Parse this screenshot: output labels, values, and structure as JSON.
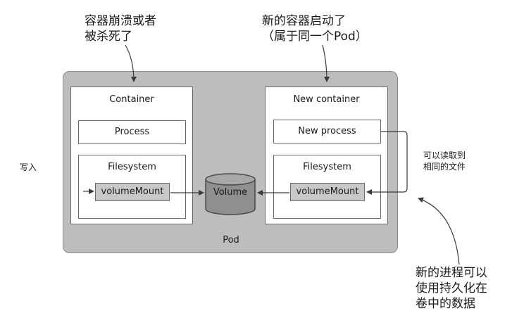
{
  "annotations": {
    "crash": [
      "容器崩溃或者",
      "被杀死了"
    ],
    "new_container_started": [
      "新的容器启动了",
      "（属于同一个Pod）"
    ],
    "write": "写入",
    "can_read": [
      "可以读取到",
      "相同的文件"
    ],
    "persisted": [
      "新的进程可以",
      "使用持久化在",
      "卷中的数据"
    ]
  },
  "pod": {
    "label": "Pod"
  },
  "old_container": {
    "title": "Container",
    "process": "Process",
    "filesystem": "Filesystem",
    "volume_mount": "volumeMount"
  },
  "new_container": {
    "title": "New container",
    "process": "New process",
    "filesystem": "Filesystem",
    "volume_mount": "volumeMount"
  },
  "volume": {
    "label": "Volume"
  },
  "colors": {
    "pod_fill": "#bdbdbd",
    "volume_fill": "#8f8f8f",
    "volume_mount_fill": "#c8c8c8",
    "stroke": "#4a4a4a"
  }
}
